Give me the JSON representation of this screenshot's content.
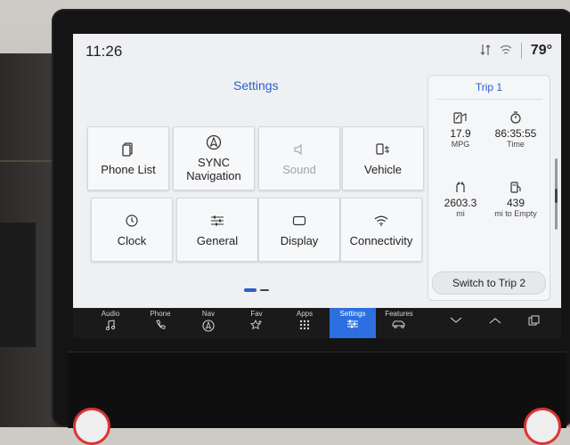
{
  "status": {
    "time": "11:26",
    "temperature": "79°"
  },
  "settings": {
    "title": "Settings",
    "tiles": [
      {
        "label": "Phone List",
        "icon": "phone-list-icon",
        "enabled": true
      },
      {
        "label": "SYNC\nNavigation",
        "icon": "navigation-icon",
        "enabled": true
      },
      {
        "label": "Sound",
        "icon": "speaker-icon",
        "enabled": false
      },
      {
        "label": "Vehicle",
        "icon": "vehicle-icon",
        "enabled": true
      },
      {
        "label": "Clock",
        "icon": "clock-icon",
        "enabled": true
      },
      {
        "label": "General",
        "icon": "sliders-icon",
        "enabled": true
      },
      {
        "label": "Display",
        "icon": "display-icon",
        "enabled": true
      },
      {
        "label": "Connectivity",
        "icon": "wifi-icon",
        "enabled": true
      }
    ]
  },
  "trip": {
    "title": "Trip 1",
    "metrics": [
      {
        "value": "17.9",
        "unit": "MPG"
      },
      {
        "value": "86:35:55",
        "unit": "Time"
      },
      {
        "value": "2603.3",
        "unit": "mi"
      },
      {
        "value": "439",
        "unit": "mi to Empty"
      }
    ],
    "switch_label": "Switch to Trip 2"
  },
  "nav": {
    "items": [
      "Audio",
      "Phone",
      "Nav",
      "Fav",
      "Apps",
      "Settings",
      "Features"
    ],
    "active": "Settings"
  },
  "colors": {
    "accent": "#2a5fc9",
    "nav_active": "#2c6fe0",
    "nav_bg": "#1a1a1a"
  }
}
